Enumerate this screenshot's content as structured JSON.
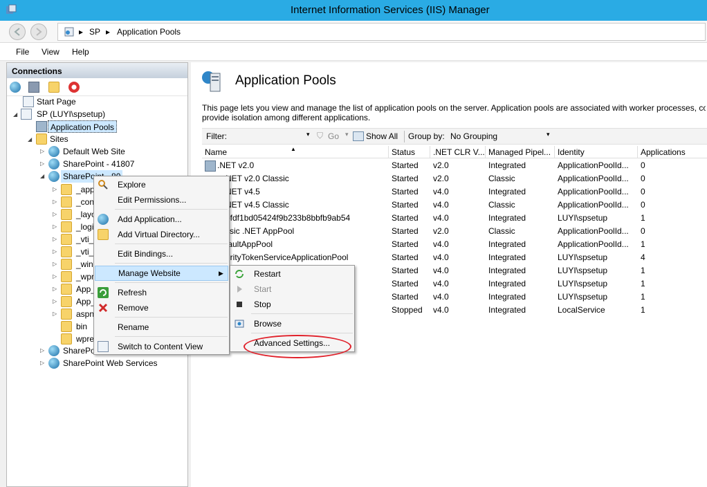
{
  "window": {
    "title": "Internet Information Services (IIS) Manager"
  },
  "address": {
    "crumbs": [
      "SP",
      "Application Pools"
    ]
  },
  "menubar": {
    "items": [
      "File",
      "View",
      "Help"
    ]
  },
  "connections": {
    "header": "Connections",
    "tree": {
      "start_page": "Start Page",
      "server": "SP (LUYI\\spsetup)",
      "app_pools": "Application Pools",
      "sites": "Sites",
      "default_site": "Default Web Site",
      "sp41807": "SharePoint - 41807",
      "sp80": "SharePoint - 80",
      "children": [
        "_app",
        "_con",
        "_layo",
        "_logi",
        "_vti_",
        "_vti_",
        "_win",
        "_wpr",
        "App_",
        "App_",
        "aspn",
        "bin",
        "wpre"
      ],
      "sp_more": "SharePo",
      "sp_web_services": "SharePoint Web Services"
    }
  },
  "main": {
    "title": "Application Pools",
    "description_line1": "This page lets you view and manage the list of application pools on the server. Application pools are associated with worker processes, con",
    "description_line2": "provide isolation among different applications.",
    "filter_label": "Filter:",
    "go_label": "Go",
    "show_all_label": "Show All",
    "group_by_label": "Group by:",
    "group_by_value": "No Grouping",
    "columns": [
      "Name",
      "Status",
      ".NET CLR V...",
      "Managed Pipel...",
      "Identity",
      "Applications"
    ],
    "rows": [
      {
        "name": ".NET v2.0",
        "status": "Started",
        "clr": "v2.0",
        "pipeline": "Integrated",
        "identity": "ApplicationPoolId...",
        "apps": "0"
      },
      {
        "name": "NET v2.0 Classic",
        "status": "Started",
        "clr": "v2.0",
        "pipeline": "Classic",
        "identity": "ApplicationPoolId...",
        "apps": "0"
      },
      {
        "name": "NET v4.5",
        "status": "Started",
        "clr": "v4.0",
        "pipeline": "Integrated",
        "identity": "ApplicationPoolId...",
        "apps": "0"
      },
      {
        "name": "NET v4.5 Classic",
        "status": "Started",
        "clr": "v4.0",
        "pipeline": "Classic",
        "identity": "ApplicationPoolId...",
        "apps": "0"
      },
      {
        "name": "bfdf1bd05424f9b233b8bbfb9ab54",
        "status": "Started",
        "clr": "v4.0",
        "pipeline": "Integrated",
        "identity": "LUYI\\spsetup",
        "apps": "1"
      },
      {
        "name": "ssic .NET AppPool",
        "status": "Started",
        "clr": "v2.0",
        "pipeline": "Classic",
        "identity": "ApplicationPoolId...",
        "apps": "0"
      },
      {
        "name": "faultAppPool",
        "status": "Started",
        "clr": "v4.0",
        "pipeline": "Integrated",
        "identity": "ApplicationPoolId...",
        "apps": "1"
      },
      {
        "name": "urityTokenServiceApplicationPool",
        "status": "Started",
        "clr": "v4.0",
        "pipeline": "Integrated",
        "identity": "LUYI\\spsetup",
        "apps": "4"
      },
      {
        "name": "",
        "status": "Started",
        "clr": "v4.0",
        "pipeline": "Integrated",
        "identity": "LUYI\\spsetup",
        "apps": "1"
      },
      {
        "name": "",
        "status": "Started",
        "clr": "v4.0",
        "pipeline": "Integrated",
        "identity": "LUYI\\spsetup",
        "apps": "1"
      },
      {
        "name": "",
        "status": "Started",
        "clr": "v4.0",
        "pipeline": "Integrated",
        "identity": "LUYI\\spsetup",
        "apps": "1"
      },
      {
        "name": "",
        "status": "Stopped",
        "clr": "v4.0",
        "pipeline": "Integrated",
        "identity": "LocalService",
        "apps": "1"
      }
    ]
  },
  "context_menu": {
    "items": [
      "Explore",
      "Edit Permissions...",
      "Add Application...",
      "Add Virtual Directory...",
      "Edit Bindings...",
      "Manage Website",
      "Refresh",
      "Remove",
      "Rename",
      "Switch to Content View"
    ]
  },
  "submenu": {
    "items": [
      "Restart",
      "Start",
      "Stop",
      "Browse",
      "Advanced Settings..."
    ]
  },
  "colors": {
    "titlebar": "#2aabe4",
    "highlight": "#cce8ff",
    "annotation": "#e0202a"
  }
}
